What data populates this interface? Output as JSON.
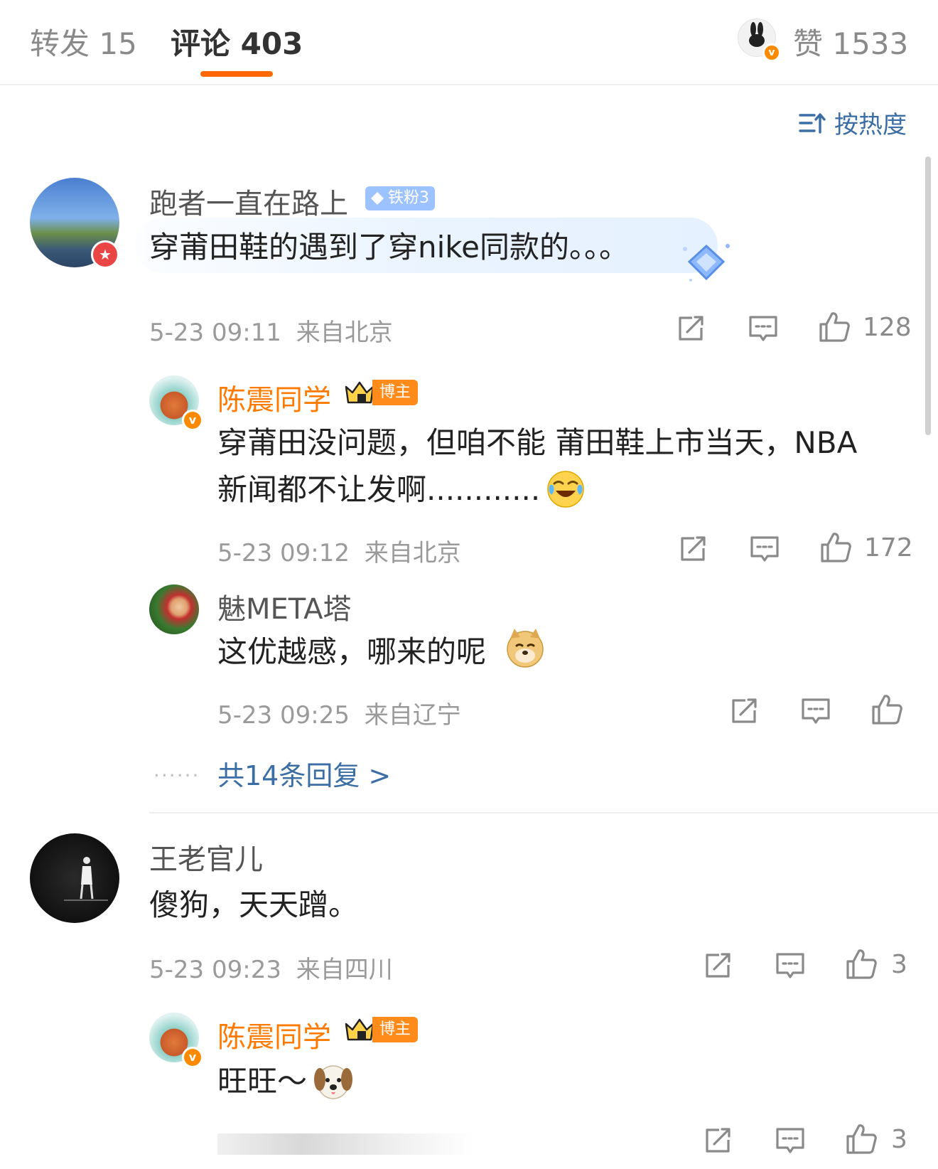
{
  "tabs": [
    {
      "label": "转发 15"
    },
    {
      "label": "评论 403"
    }
  ],
  "likes_label": "赞 1533",
  "sort_label": "按热度",
  "comments": [
    {
      "user": "跑者一直在路上",
      "fan_badge": "铁粉3",
      "text": "穿莆田鞋的遇到了穿nike同款的。。。",
      "time": "5-23 09:11",
      "location": "来自北京",
      "likes": "128",
      "replies": [
        {
          "user": "陈震同学",
          "badge": "博主",
          "text_line1": "穿莆田没问题，但咱不能 莆田鞋上市当天，NBA",
          "text_line2": "新闻都不让发啊............",
          "emoji": "laugh-cry-emoji",
          "time": "5-23 09:12",
          "location": "来自北京",
          "likes": "172"
        },
        {
          "user": "魅META塔",
          "text": "这优越感，哪来的呢",
          "emoji": "doge-emoji",
          "time": "5-23 09:25",
          "location": "来自辽宁",
          "likes": ""
        }
      ],
      "more_replies": "共14条回复 >",
      "more_dots": "......"
    },
    {
      "user": "王老官儿",
      "text": "傻狗，天天蹭。",
      "time": "5-23 09:23",
      "location": "来自四川",
      "likes": "3",
      "replies": [
        {
          "user": "陈震同学",
          "badge": "博主",
          "text": "旺旺～",
          "emoji": "dog-emoji",
          "likes": "3"
        }
      ]
    }
  ],
  "colors": {
    "accent": "#ff6a00",
    "link": "#3a6ea5",
    "blogger": "#ff7a00",
    "meta": "#9a9a9a"
  }
}
